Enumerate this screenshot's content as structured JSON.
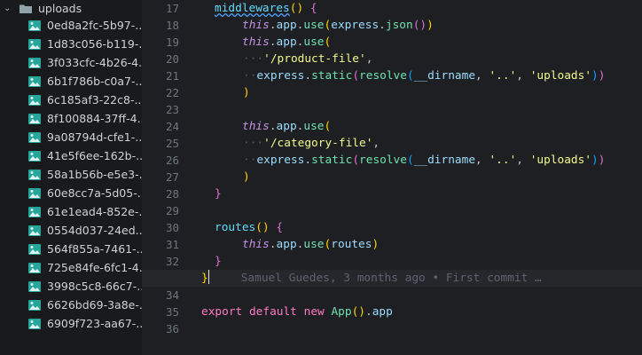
{
  "sidebar": {
    "folder_label": "uploads",
    "files": [
      "0ed8a2fc-5b97-...",
      "1d83c056-b119-...",
      "3f033cfc-4b26-4...",
      "6b1f786b-c0a7-...",
      "6c185af3-22c8-...",
      "8f100884-37ff-4...",
      "9a08794d-cfe1-...",
      "41e5f6ee-162b-...",
      "58a1b56b-e5e3-...",
      "60e8cc7a-5d05-...",
      "61e1ead4-852e-...",
      "0554d037-24ed...",
      "564f855a-7461-...",
      "725e84fe-6fc1-4...",
      "3998c5c8-66c7-...",
      "6626bd69-3a8e-...",
      "6909f723-aa67-..."
    ]
  },
  "editor": {
    "line_numbers": [
      "17",
      "18",
      "19",
      "20",
      "21",
      "22",
      "23",
      "24",
      "25",
      "26",
      "27",
      "28",
      "29",
      "30",
      "31",
      "32",
      "33",
      "34",
      "35",
      "36"
    ],
    "active_line": "33",
    "blame": "Samuel Guedes, 3 months ago • First commit …",
    "tokens": {
      "middlewares": "middlewares",
      "routes": "routes",
      "this": "this",
      "app": "app",
      "use": "use",
      "express": "express",
      "json": "json",
      "static": "static",
      "resolve": "resolve",
      "dirname": "__dirname",
      "dotdot": "'..'",
      "uploads": "'uploads'",
      "product_file": "'/product-file'",
      "category_file": "'/category-file'",
      "export": "export",
      "default": "default",
      "new": "new",
      "App": "App"
    }
  }
}
